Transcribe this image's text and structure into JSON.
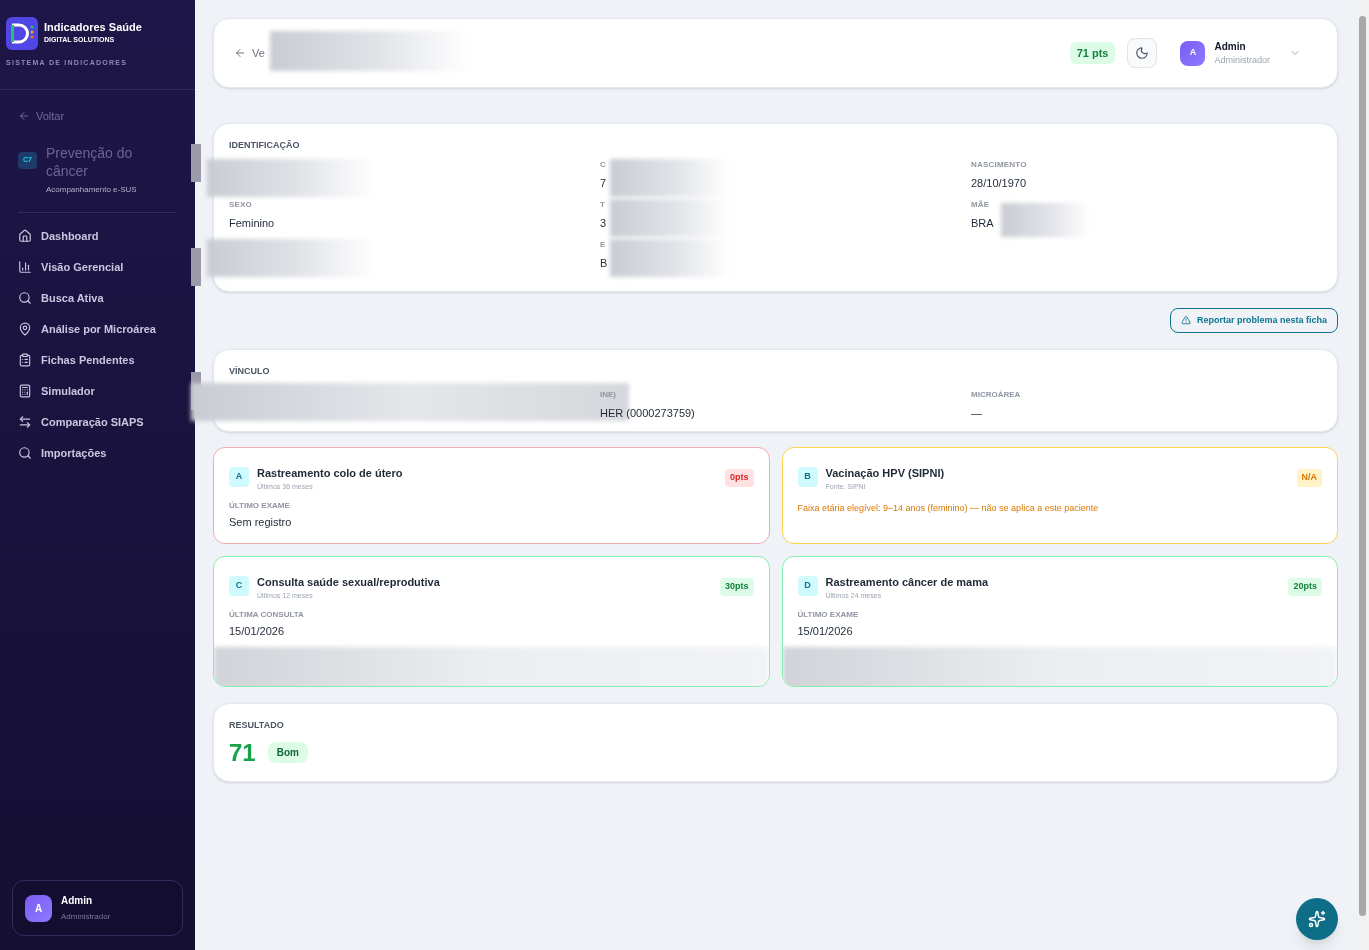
{
  "sidebar": {
    "brand": {
      "name": "Indicadores Saúde",
      "tagline": "DIGITAL SOLUTIONS",
      "system": "SISTEMA DE INDICADORES"
    },
    "back": "Voltar",
    "indicator": {
      "code": "C7",
      "title": "Prevenção do câncer",
      "subtitle": "Acompanhamento e-SUS",
      "redacted": true
    },
    "nav": [
      {
        "label": "Dashboard"
      },
      {
        "label": "Visão Gerencial",
        "redacted": true
      },
      {
        "label": "Busca Ativa"
      },
      {
        "label": "Análise por Microárea"
      },
      {
        "label": "Fichas Pendentes"
      },
      {
        "label": "Simulador",
        "redacted": true
      },
      {
        "label": "Comparação SIAPS"
      },
      {
        "label": "Importações"
      }
    ],
    "user": {
      "initial": "A",
      "name": "Admin",
      "role": "Administrador"
    }
  },
  "header": {
    "back": "Ve",
    "points": "71 pts",
    "user": {
      "initial": "A",
      "name": "Admin",
      "role": "Administrador"
    }
  },
  "identification": {
    "title": "IDENTIFICAÇÃO",
    "fields": [
      {
        "redacted": true
      },
      {
        "label": "C",
        "value": "7",
        "redacted": true
      },
      {
        "label": "NASCIMENTO",
        "value": "28/10/1970"
      },
      {
        "label": "SEXO",
        "value": "Feminino"
      },
      {
        "label": "T",
        "value": "3",
        "redacted": true
      },
      {
        "label": "MÃE",
        "value": "BRA",
        "redacted": true
      },
      {
        "redacted": true
      },
      {
        "label": "E",
        "value": "B",
        "redacted": true
      }
    ]
  },
  "report_button": "Reportar problema nesta ficha",
  "link": {
    "title": "VÍNCULO",
    "fields": [
      {
        "redacted": true
      },
      {
        "label": "INE)",
        "value": "HER (0000273759)"
      },
      {
        "label": "MICROÁREA",
        "value": "—"
      }
    ]
  },
  "criteria": [
    {
      "letter": "A",
      "title": "Rastreamento colo de útero",
      "subtitle": "Últimos 36 meses",
      "badge": "0pts",
      "kind": "fail",
      "field_label": "ÚLTIMO EXAME",
      "value": "Sem registro"
    },
    {
      "letter": "B",
      "title": "Vacinação HPV (SIPNI)",
      "subtitle": "Fonte: SIPNI",
      "badge": "N/A",
      "kind": "na",
      "note": "Faixa etária elegível: 9–14 anos (feminino) — não se aplica a este paciente"
    },
    {
      "letter": "C",
      "title": "Consulta saúde sexual/reprodutiva",
      "subtitle": "Últimos 12 meses",
      "badge": "30pts",
      "kind": "ok",
      "field_label": "ÚLTIMA CONSULTA",
      "value": "15/01/2026",
      "redacted": true
    },
    {
      "letter": "D",
      "title": "Rastreamento câncer de mama",
      "subtitle": "Últimos 24 meses",
      "badge": "20pts",
      "kind": "ok",
      "field_label": "ÚLTIMO EXAME",
      "value": "15/01/2026",
      "redacted": true
    }
  ],
  "result": {
    "title": "RESULTADO",
    "score": "71",
    "rating": "Bom"
  }
}
